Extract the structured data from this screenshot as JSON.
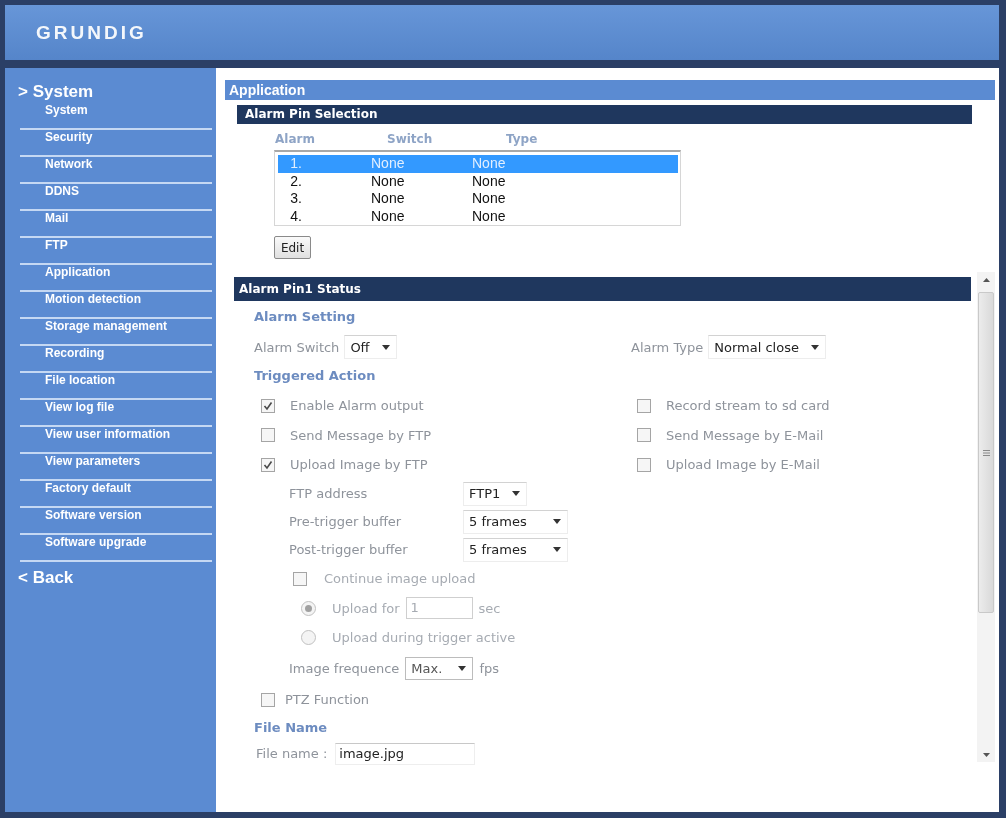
{
  "header": {
    "logo": "GRUNDIG"
  },
  "sidebar": {
    "section": "> System",
    "items": [
      "System",
      "Security",
      "Network",
      "DDNS",
      "Mail",
      "FTP",
      "Application",
      "Motion detection",
      "Storage management",
      "Recording",
      "File location",
      "View log file",
      "View user information",
      "View parameters",
      "Factory default",
      "Software version",
      "Software upgrade"
    ],
    "back": "< Back"
  },
  "page_title": "Application",
  "alarm_pin_selection": {
    "title": "Alarm Pin Selection",
    "columns": [
      "Alarm",
      "Switch",
      "Type"
    ],
    "rows": [
      {
        "cells": [
          "1.",
          "None",
          "None"
        ],
        "selected": true
      },
      {
        "cells": [
          "2.",
          "None",
          "None"
        ],
        "selected": false
      },
      {
        "cells": [
          "3.",
          "None",
          "None"
        ],
        "selected": false
      },
      {
        "cells": [
          "4.",
          "None",
          "None"
        ],
        "selected": false
      }
    ],
    "edit_button": "Edit"
  },
  "alarm_pin_status": {
    "title": "Alarm Pin1 Status",
    "alarm_setting": {
      "heading": "Alarm Setting",
      "fields": [
        {
          "label": "Alarm Switch",
          "value": "Off"
        },
        {
          "label": "Alarm Type",
          "value": "Normal close"
        }
      ]
    },
    "triggered_action": {
      "heading": "Triggered Action",
      "options": [
        {
          "label": "Enable Alarm output",
          "checked": true
        },
        {
          "label": "Record stream to sd card",
          "checked": false
        },
        {
          "label": "Send Message by FTP",
          "checked": false
        },
        {
          "label": "Send Message by E-Mail",
          "checked": false
        },
        {
          "label": "Upload Image by FTP",
          "checked": true
        },
        {
          "label": "Upload Image by E-Mail",
          "checked": false
        }
      ]
    },
    "ftp_settings": [
      {
        "label": "FTP address",
        "value": "FTP1"
      },
      {
        "label": "Pre-trigger buffer",
        "value": "5 frames"
      },
      {
        "label": "Post-trigger buffer",
        "value": "5 frames"
      }
    ],
    "continue_upload": {
      "label": "Continue image upload",
      "checked": false
    },
    "upload_modes": [
      {
        "kind": "duration",
        "label": "Upload for",
        "value": "1",
        "unit": "sec",
        "selected": true
      },
      {
        "kind": "plain",
        "label": "Upload during trigger active",
        "selected": false
      }
    ],
    "image_frequency": {
      "label": "Image frequence",
      "value": "Max.",
      "unit": "fps"
    },
    "ptz": {
      "label": "PTZ Function",
      "checked": false
    },
    "file_name": {
      "heading": "File Name",
      "label": "File name :",
      "value": "image.jpg"
    }
  }
}
